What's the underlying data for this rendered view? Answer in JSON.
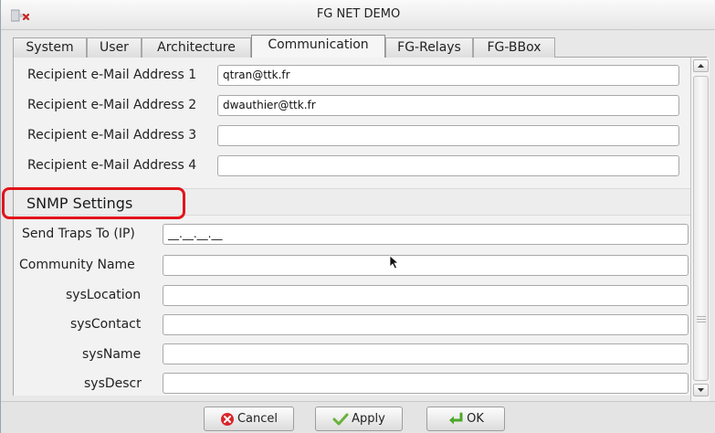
{
  "window": {
    "title": "FG NET DEMO"
  },
  "tabs": [
    {
      "label": "System",
      "active": false
    },
    {
      "label": "User",
      "active": false
    },
    {
      "label": "Architecture",
      "active": false
    },
    {
      "label": "Communication",
      "active": true
    },
    {
      "label": "FG-Relays",
      "active": false
    },
    {
      "label": "FG-BBox",
      "active": false
    }
  ],
  "email": {
    "fields": [
      {
        "label": "Recipient e-Mail Address 1",
        "value": "qtran@ttk.fr"
      },
      {
        "label": "Recipient e-Mail Address 2",
        "value": "dwauthier@ttk.fr"
      },
      {
        "label": "Recipient e-Mail Address 3",
        "value": ""
      },
      {
        "label": "Recipient e-Mail Address 4",
        "value": ""
      }
    ]
  },
  "snmp": {
    "section_title": "SNMP Settings",
    "fields": [
      {
        "label": "Send Traps To (IP)",
        "value": "__.__.__.__"
      },
      {
        "label": "Community Name",
        "value": ""
      },
      {
        "label": "sysLocation",
        "value": ""
      },
      {
        "label": "sysContact",
        "value": ""
      },
      {
        "label": "sysName",
        "value": ""
      },
      {
        "label": "sysDescr",
        "value": ""
      }
    ]
  },
  "buttons": {
    "cancel": "Cancel",
    "apply": "Apply",
    "ok": "OK"
  },
  "colors": {
    "highlight": "#e2141b",
    "cancel_icon": "#d9262b",
    "apply_icon": "#6ab23c",
    "ok_icon": "#4ea82a"
  }
}
